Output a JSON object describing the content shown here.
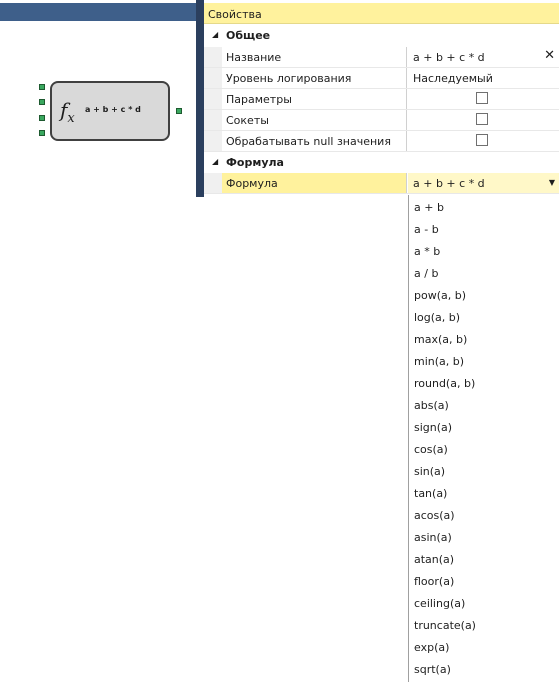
{
  "canvas": {
    "node_label": "a + b + c * d",
    "node_icon": "fx-icon"
  },
  "properties": {
    "title": "Свойства",
    "categories": [
      {
        "label": "Общее"
      },
      {
        "label": "Формула"
      }
    ],
    "rows": [
      {
        "name": "Название",
        "value": "a + b + c * d",
        "type": "text"
      },
      {
        "name": "Уровень логирования",
        "value": "Наследуемый",
        "type": "text"
      },
      {
        "name": "Параметры",
        "value": "",
        "type": "checkbox",
        "checked": false
      },
      {
        "name": "Сокеты",
        "value": "",
        "type": "checkbox",
        "checked": false
      },
      {
        "name": "Обрабатывать null значения",
        "value": "",
        "type": "checkbox",
        "checked": false
      },
      {
        "name": "Формула",
        "value": "a + b + c * d",
        "type": "dropdown"
      }
    ]
  },
  "dropdown": {
    "options": [
      "a + b",
      "a - b",
      "a * b",
      "a / b",
      "pow(a, b)",
      "log(a, b)",
      "max(a, b)",
      "min(a, b)",
      "round(a, b)",
      "abs(a)",
      "sign(a)",
      "cos(a)",
      "sin(a)",
      "tan(a)",
      "acos(a)",
      "asin(a)",
      "atan(a)",
      "floor(a)",
      "ceiling(a)",
      "truncate(a)",
      "exp(a)",
      "sqrt(a)"
    ]
  },
  "colors": {
    "accent_yellow": "#fff29d",
    "panel_blue": "#3e5f8a",
    "port_green": "#3aa85f"
  }
}
